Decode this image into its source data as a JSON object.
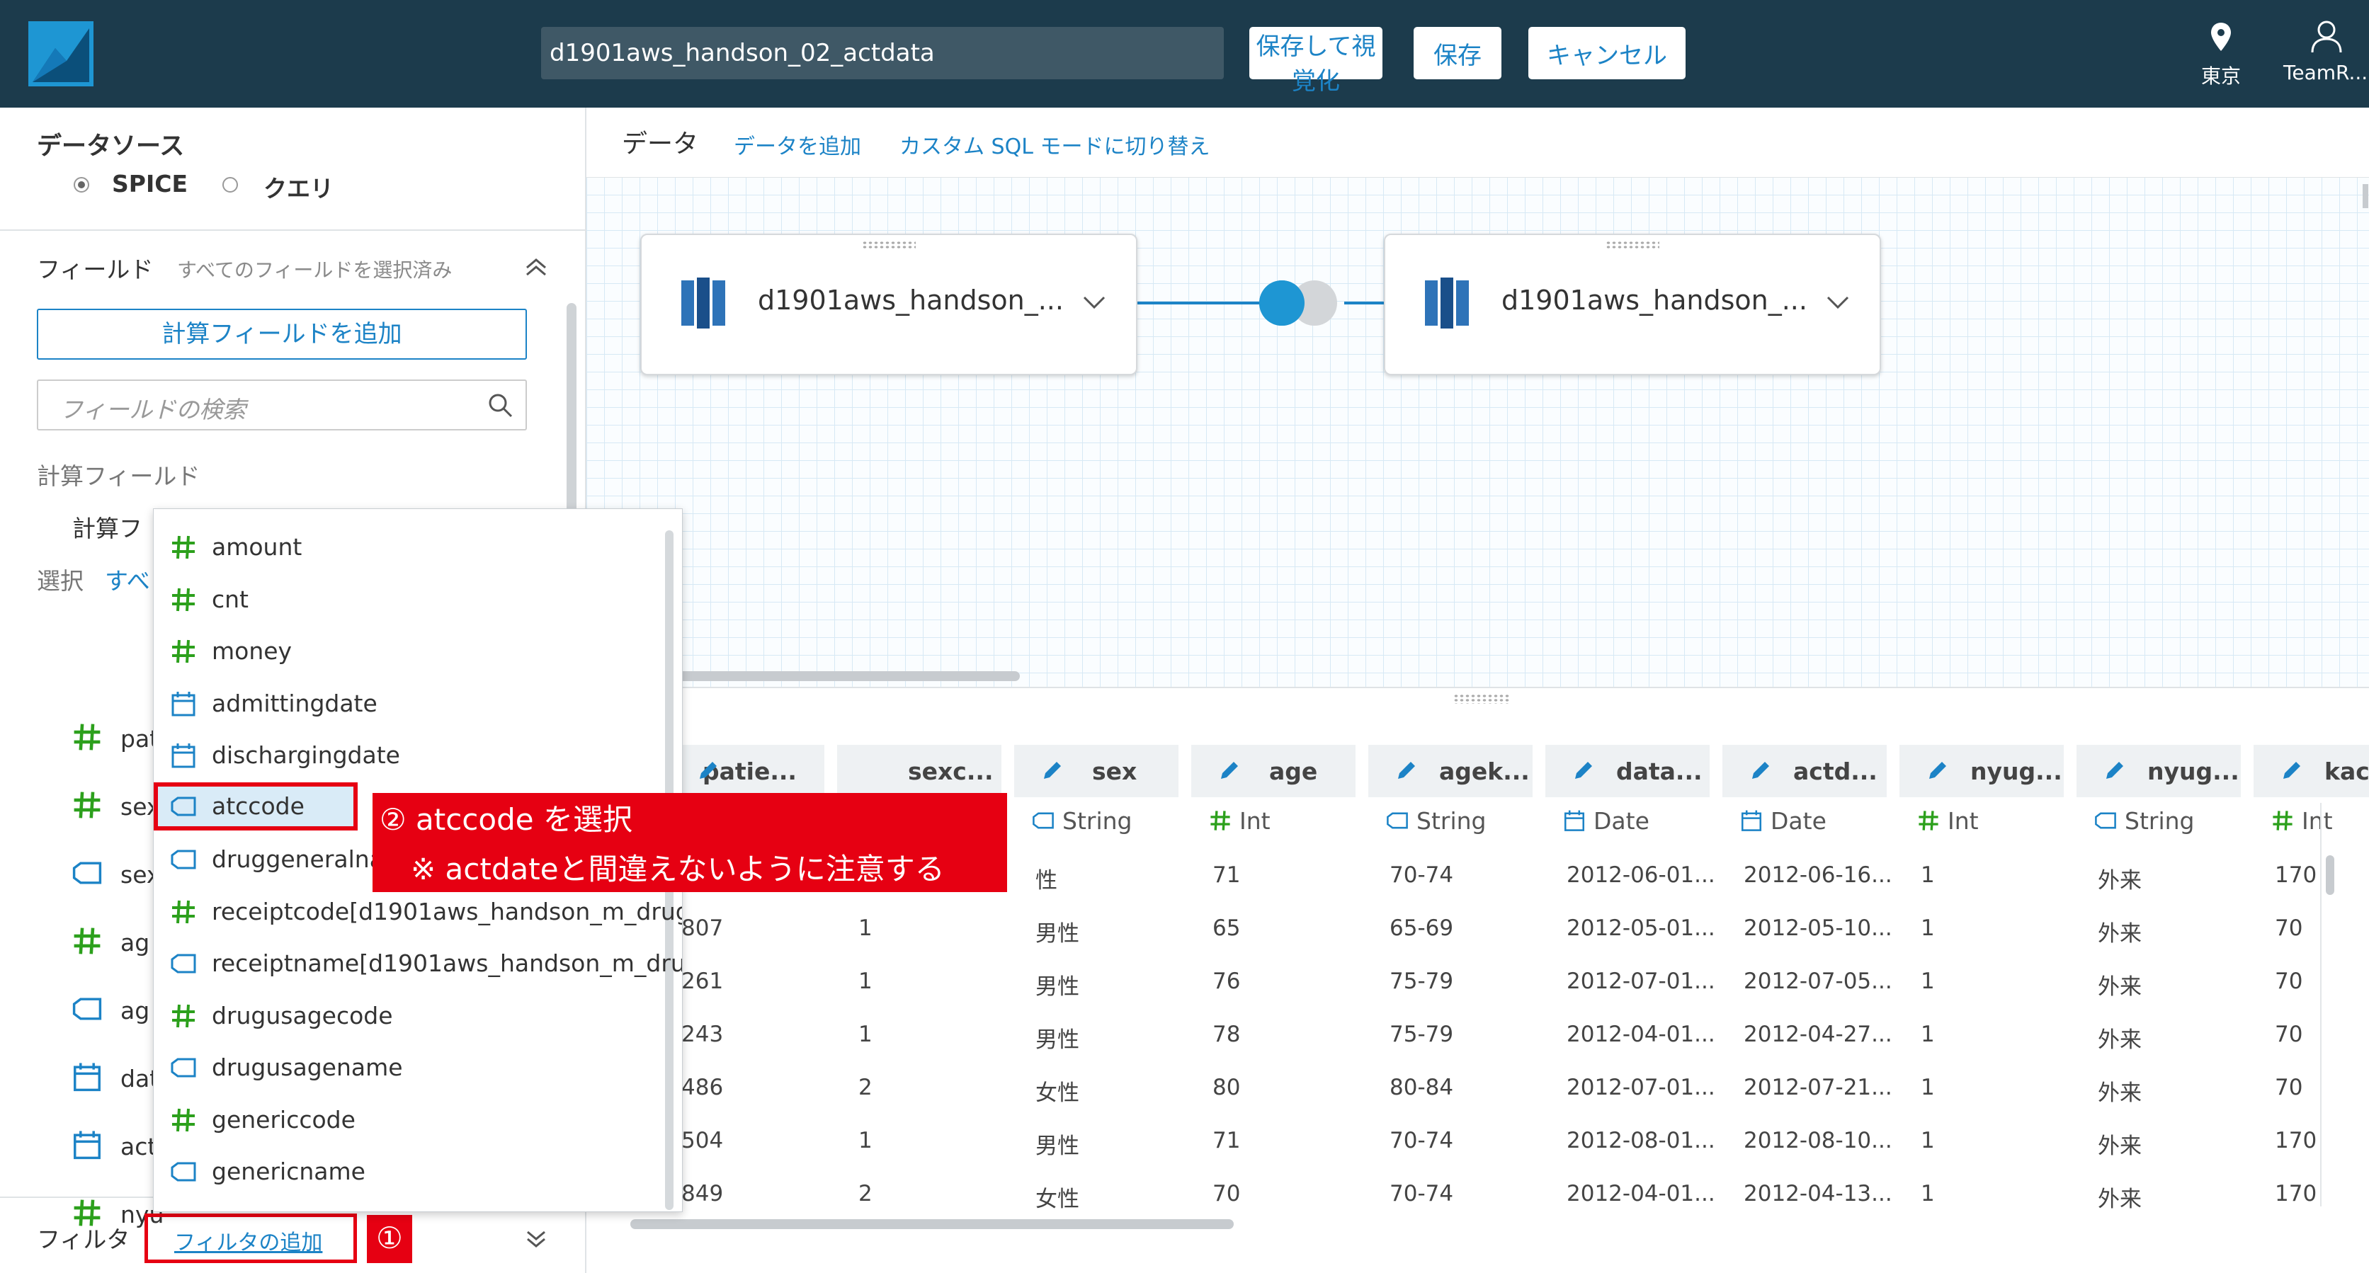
{
  "header": {
    "dataset_name": "d1901aws_handson_02_actdata",
    "save_visualize_label": "保存して視覚化",
    "save_label": "保存",
    "cancel_label": "キャンセル",
    "region_label": "東京",
    "account_label": "TeamR..."
  },
  "left": {
    "datasource_title": "データソース",
    "mode_spice": "SPICE",
    "mode_query": "クエリ",
    "fields_title": "フィールド",
    "fields_status": "すべてのフィールドを選択済み",
    "add_calc_field": "計算フィールドを追加",
    "search_placeholder": "フィールドの検索",
    "calc_fields_heading": "計算フィールド",
    "calc_field_item": "計算フ",
    "select_label": "選択",
    "select_all": "すべ",
    "field_items": [
      {
        "label": "pat",
        "icon": "number-icon"
      },
      {
        "label": "sex",
        "icon": "number-icon"
      },
      {
        "label": "sex",
        "icon": "string-icon"
      },
      {
        "label": "ag",
        "icon": "number-icon"
      },
      {
        "label": "ag",
        "icon": "string-icon"
      },
      {
        "label": "dat",
        "icon": "date-icon"
      },
      {
        "label": "act",
        "icon": "date-icon"
      },
      {
        "label": "nyu",
        "icon": "number-icon"
      }
    ],
    "filter_title": "フィルタ",
    "add_filter": "フィルタの追加"
  },
  "main": {
    "data_tab": "データ",
    "add_data": "データを追加",
    "sql_mode": "カスタム SQL モードに切り替え",
    "card_left": "d1901aws_handson_...",
    "card_right": "d1901aws_handson_..."
  },
  "table": {
    "columns": [
      {
        "name": "patie...",
        "type": "",
        "type_icon": ""
      },
      {
        "name": "sexc...",
        "type": "",
        "type_icon": ""
      },
      {
        "name": "sex",
        "type": "String",
        "type_icon": "string-icon"
      },
      {
        "name": "age",
        "type": "Int",
        "type_icon": "number-icon"
      },
      {
        "name": "agek...",
        "type": "String",
        "type_icon": "string-icon"
      },
      {
        "name": "data...",
        "type": "Date",
        "type_icon": "date-icon"
      },
      {
        "name": "actd...",
        "type": "Date",
        "type_icon": "date-icon"
      },
      {
        "name": "nyug...",
        "type": "Int",
        "type_icon": "number-icon"
      },
      {
        "name": "nyug...",
        "type": "String",
        "type_icon": "string-icon"
      },
      {
        "name": "kaсс",
        "type": "Int",
        "type_icon": "number-icon"
      }
    ],
    "rows": [
      [
        "",
        "",
        "性",
        "71",
        "70-74",
        "2012-06-01...",
        "2012-06-16...",
        "1",
        "外来",
        "170"
      ],
      [
        "807",
        "1",
        "男性",
        "65",
        "65-69",
        "2012-05-01...",
        "2012-05-10...",
        "1",
        "外来",
        "70"
      ],
      [
        "261",
        "1",
        "男性",
        "76",
        "75-79",
        "2012-07-01...",
        "2012-07-05...",
        "1",
        "外来",
        "70"
      ],
      [
        "243",
        "1",
        "男性",
        "78",
        "75-79",
        "2012-04-01...",
        "2012-04-27...",
        "1",
        "外来",
        "70"
      ],
      [
        "486",
        "2",
        "女性",
        "80",
        "80-84",
        "2012-07-01...",
        "2012-07-21...",
        "1",
        "外来",
        "70"
      ],
      [
        "504",
        "1",
        "男性",
        "71",
        "70-74",
        "2012-08-01...",
        "2012-08-10...",
        "1",
        "外来",
        "170"
      ],
      [
        "849",
        "2",
        "女性",
        "70",
        "70-74",
        "2012-04-01...",
        "2012-04-13...",
        "1",
        "外来",
        "170"
      ]
    ]
  },
  "dropdown": {
    "items": [
      {
        "label": "amount",
        "icon": "number-icon"
      },
      {
        "label": "cnt",
        "icon": "number-icon"
      },
      {
        "label": "money",
        "icon": "number-icon"
      },
      {
        "label": "admittingdate",
        "icon": "date-icon"
      },
      {
        "label": "dischargingdate",
        "icon": "date-icon"
      },
      {
        "label": "atccode",
        "icon": "string-icon"
      },
      {
        "label": "druggeneralna",
        "icon": "string-icon"
      },
      {
        "label": "receiptcode[d1901aws_handson_m_drug",
        "icon": "number-icon"
      },
      {
        "label": "receiptname[d1901aws_handson_m_dru",
        "icon": "string-icon"
      },
      {
        "label": "drugusagecode",
        "icon": "number-icon"
      },
      {
        "label": "drugusagename",
        "icon": "string-icon"
      },
      {
        "label": "genericcode",
        "icon": "number-icon"
      },
      {
        "label": "genericname",
        "icon": "string-icon"
      }
    ],
    "selected": "atccode"
  },
  "annotations": {
    "step2_line1": "② atccode を選択",
    "step2_line2": "※ actdateと間違えないように注意する",
    "step1": "①"
  },
  "colors": {
    "header_bg": "#1c3b4c",
    "accent": "#1c83c6",
    "number_icon": "#2ca01c",
    "annotation_red": "#e60012"
  }
}
